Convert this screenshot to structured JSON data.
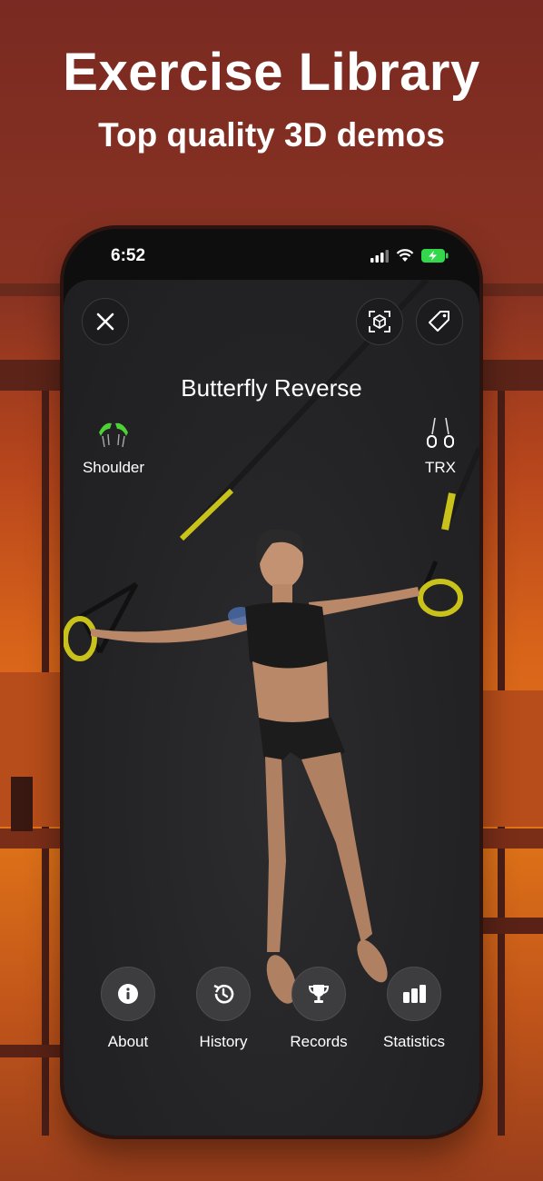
{
  "promo": {
    "headline": "Exercise Library",
    "subheadline": "Top quality 3D demos"
  },
  "status_bar": {
    "time": "6:52",
    "icons": [
      "signal-icon",
      "wifi-icon",
      "battery-charging-icon"
    ]
  },
  "exercise": {
    "name": "Butterfly Reverse",
    "muscle": "Shoulder",
    "equipment": "TRX"
  },
  "top_buttons": [
    "close-icon",
    "ar-view-icon",
    "tag-icon"
  ],
  "bottom_actions": [
    {
      "label": "About",
      "icon": "info-icon"
    },
    {
      "label": "History",
      "icon": "history-icon"
    },
    {
      "label": "Records",
      "icon": "trophy-icon"
    },
    {
      "label": "Statistics",
      "icon": "bar-chart-icon"
    }
  ],
  "colors": {
    "strap_accent": "#c9c21a",
    "muscle_highlight": "#4cd137",
    "screen_bg": "#262628"
  }
}
